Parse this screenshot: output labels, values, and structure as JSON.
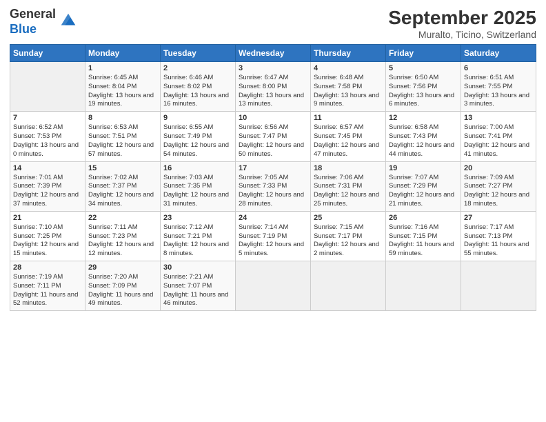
{
  "logo": {
    "general": "General",
    "blue": "Blue"
  },
  "title": {
    "month_year": "September 2025",
    "location": "Muralto, Ticino, Switzerland"
  },
  "days": [
    "Sunday",
    "Monday",
    "Tuesday",
    "Wednesday",
    "Thursday",
    "Friday",
    "Saturday"
  ],
  "weeks": [
    [
      {
        "day": "",
        "sunrise": "",
        "sunset": "",
        "daylight": ""
      },
      {
        "day": "1",
        "sunrise": "Sunrise: 6:45 AM",
        "sunset": "Sunset: 8:04 PM",
        "daylight": "Daylight: 13 hours and 19 minutes."
      },
      {
        "day": "2",
        "sunrise": "Sunrise: 6:46 AM",
        "sunset": "Sunset: 8:02 PM",
        "daylight": "Daylight: 13 hours and 16 minutes."
      },
      {
        "day": "3",
        "sunrise": "Sunrise: 6:47 AM",
        "sunset": "Sunset: 8:00 PM",
        "daylight": "Daylight: 13 hours and 13 minutes."
      },
      {
        "day": "4",
        "sunrise": "Sunrise: 6:48 AM",
        "sunset": "Sunset: 7:58 PM",
        "daylight": "Daylight: 13 hours and 9 minutes."
      },
      {
        "day": "5",
        "sunrise": "Sunrise: 6:50 AM",
        "sunset": "Sunset: 7:56 PM",
        "daylight": "Daylight: 13 hours and 6 minutes."
      },
      {
        "day": "6",
        "sunrise": "Sunrise: 6:51 AM",
        "sunset": "Sunset: 7:55 PM",
        "daylight": "Daylight: 13 hours and 3 minutes."
      }
    ],
    [
      {
        "day": "7",
        "sunrise": "Sunrise: 6:52 AM",
        "sunset": "Sunset: 7:53 PM",
        "daylight": "Daylight: 13 hours and 0 minutes."
      },
      {
        "day": "8",
        "sunrise": "Sunrise: 6:53 AM",
        "sunset": "Sunset: 7:51 PM",
        "daylight": "Daylight: 12 hours and 57 minutes."
      },
      {
        "day": "9",
        "sunrise": "Sunrise: 6:55 AM",
        "sunset": "Sunset: 7:49 PM",
        "daylight": "Daylight: 12 hours and 54 minutes."
      },
      {
        "day": "10",
        "sunrise": "Sunrise: 6:56 AM",
        "sunset": "Sunset: 7:47 PM",
        "daylight": "Daylight: 12 hours and 50 minutes."
      },
      {
        "day": "11",
        "sunrise": "Sunrise: 6:57 AM",
        "sunset": "Sunset: 7:45 PM",
        "daylight": "Daylight: 12 hours and 47 minutes."
      },
      {
        "day": "12",
        "sunrise": "Sunrise: 6:58 AM",
        "sunset": "Sunset: 7:43 PM",
        "daylight": "Daylight: 12 hours and 44 minutes."
      },
      {
        "day": "13",
        "sunrise": "Sunrise: 7:00 AM",
        "sunset": "Sunset: 7:41 PM",
        "daylight": "Daylight: 12 hours and 41 minutes."
      }
    ],
    [
      {
        "day": "14",
        "sunrise": "Sunrise: 7:01 AM",
        "sunset": "Sunset: 7:39 PM",
        "daylight": "Daylight: 12 hours and 37 minutes."
      },
      {
        "day": "15",
        "sunrise": "Sunrise: 7:02 AM",
        "sunset": "Sunset: 7:37 PM",
        "daylight": "Daylight: 12 hours and 34 minutes."
      },
      {
        "day": "16",
        "sunrise": "Sunrise: 7:03 AM",
        "sunset": "Sunset: 7:35 PM",
        "daylight": "Daylight: 12 hours and 31 minutes."
      },
      {
        "day": "17",
        "sunrise": "Sunrise: 7:05 AM",
        "sunset": "Sunset: 7:33 PM",
        "daylight": "Daylight: 12 hours and 28 minutes."
      },
      {
        "day": "18",
        "sunrise": "Sunrise: 7:06 AM",
        "sunset": "Sunset: 7:31 PM",
        "daylight": "Daylight: 12 hours and 25 minutes."
      },
      {
        "day": "19",
        "sunrise": "Sunrise: 7:07 AM",
        "sunset": "Sunset: 7:29 PM",
        "daylight": "Daylight: 12 hours and 21 minutes."
      },
      {
        "day": "20",
        "sunrise": "Sunrise: 7:09 AM",
        "sunset": "Sunset: 7:27 PM",
        "daylight": "Daylight: 12 hours and 18 minutes."
      }
    ],
    [
      {
        "day": "21",
        "sunrise": "Sunrise: 7:10 AM",
        "sunset": "Sunset: 7:25 PM",
        "daylight": "Daylight: 12 hours and 15 minutes."
      },
      {
        "day": "22",
        "sunrise": "Sunrise: 7:11 AM",
        "sunset": "Sunset: 7:23 PM",
        "daylight": "Daylight: 12 hours and 12 minutes."
      },
      {
        "day": "23",
        "sunrise": "Sunrise: 7:12 AM",
        "sunset": "Sunset: 7:21 PM",
        "daylight": "Daylight: 12 hours and 8 minutes."
      },
      {
        "day": "24",
        "sunrise": "Sunrise: 7:14 AM",
        "sunset": "Sunset: 7:19 PM",
        "daylight": "Daylight: 12 hours and 5 minutes."
      },
      {
        "day": "25",
        "sunrise": "Sunrise: 7:15 AM",
        "sunset": "Sunset: 7:17 PM",
        "daylight": "Daylight: 12 hours and 2 minutes."
      },
      {
        "day": "26",
        "sunrise": "Sunrise: 7:16 AM",
        "sunset": "Sunset: 7:15 PM",
        "daylight": "Daylight: 11 hours and 59 minutes."
      },
      {
        "day": "27",
        "sunrise": "Sunrise: 7:17 AM",
        "sunset": "Sunset: 7:13 PM",
        "daylight": "Daylight: 11 hours and 55 minutes."
      }
    ],
    [
      {
        "day": "28",
        "sunrise": "Sunrise: 7:19 AM",
        "sunset": "Sunset: 7:11 PM",
        "daylight": "Daylight: 11 hours and 52 minutes."
      },
      {
        "day": "29",
        "sunrise": "Sunrise: 7:20 AM",
        "sunset": "Sunset: 7:09 PM",
        "daylight": "Daylight: 11 hours and 49 minutes."
      },
      {
        "day": "30",
        "sunrise": "Sunrise: 7:21 AM",
        "sunset": "Sunset: 7:07 PM",
        "daylight": "Daylight: 11 hours and 46 minutes."
      },
      {
        "day": "",
        "sunrise": "",
        "sunset": "",
        "daylight": ""
      },
      {
        "day": "",
        "sunrise": "",
        "sunset": "",
        "daylight": ""
      },
      {
        "day": "",
        "sunrise": "",
        "sunset": "",
        "daylight": ""
      },
      {
        "day": "",
        "sunrise": "",
        "sunset": "",
        "daylight": ""
      }
    ]
  ]
}
